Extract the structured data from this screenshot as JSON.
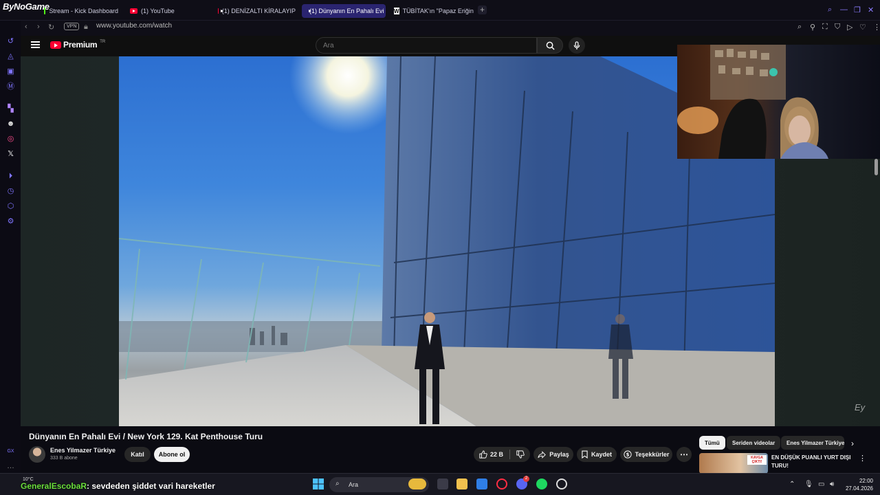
{
  "browser": {
    "brand": "ByNoGame",
    "tabs": [
      {
        "label": "Stream - Kick Dashboard",
        "icon": "kick-icon"
      },
      {
        "label": "(1) YouTube",
        "icon": "youtube-icon"
      },
      {
        "label": "(1) DENİZALTI KİRALAYIP",
        "icon": "youtube-icon"
      },
      {
        "label": "(1) Dünyanın En Pahalı Evi",
        "icon": "youtube-icon"
      },
      {
        "label": "TÜBİTAK'ın \"Papaz Eriğini",
        "icon": "w-icon"
      }
    ],
    "active_tab": 3,
    "vpn_label": "VPN",
    "url": "www.youtube.com/watch"
  },
  "youtube": {
    "logo_text": "Premium",
    "logo_region": "TR",
    "search_placeholder": "Ara",
    "notification_count": "1",
    "video_title": "Dünyanın En Pahalı Evi / New York 129. Kat Penthouse Turu",
    "channel_name": "Enes Yilmazer Türkiye",
    "subscribers": "333 B abone",
    "join_label": "Katıl",
    "subscribe_label": "Abone ol",
    "likes": "22 B",
    "share_label": "Paylaş",
    "save_label": "Kaydet",
    "thanks_label": "Teşekkürler",
    "watermark": "Ey",
    "chips": [
      "Tümü",
      "Seriden videolar",
      "Enes Yilmazer Türkiye"
    ],
    "recommended": {
      "title": "EN DÜŞÜK PUANLI YURT DIŞI TURU!",
      "thumb_label": "KAVGA ÇIKTI!"
    }
  },
  "stream_overlay": {
    "chat_user": "GeneralEscobaR",
    "chat_message": ": sevdeden şiddet vari hareketler"
  },
  "taskbar": {
    "weather": "10°C",
    "search_label": "Ara",
    "time": "22:00",
    "date": "27.04.2026",
    "discord_badge": "2"
  },
  "colors": {
    "accent_purple": "#7f74ff",
    "youtube_red": "#ff0033",
    "chat_user_green": "#6adf3b"
  }
}
